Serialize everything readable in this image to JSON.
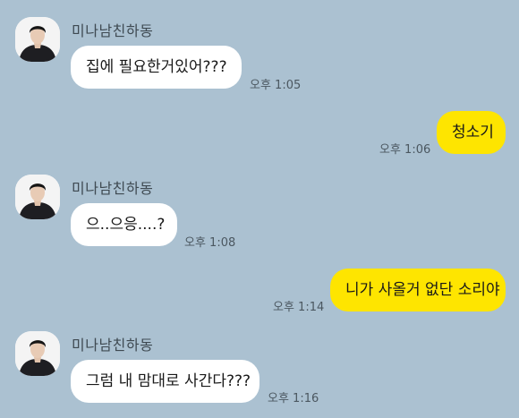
{
  "contact": {
    "name": "미나남친하동",
    "avatar_icon": "profile-photo-man-black-jacket"
  },
  "colors": {
    "background": "#abc1d1",
    "incoming_bubble": "#ffffff",
    "outgoing_bubble": "#fee500"
  },
  "messages": [
    {
      "direction": "in",
      "text": "집에 필요한거있어???",
      "time": "오후 1:05"
    },
    {
      "direction": "out",
      "text": "청소기",
      "time": "오후 1:06"
    },
    {
      "direction": "in",
      "text": "으..으응....?",
      "time": "오후 1:08"
    },
    {
      "direction": "out",
      "text": "니가 사올거 없단 소리야",
      "time": "오후 1:14"
    },
    {
      "direction": "in",
      "text": "그럼 내 맘대로 사간다???",
      "time": "오후 1:16"
    }
  ]
}
